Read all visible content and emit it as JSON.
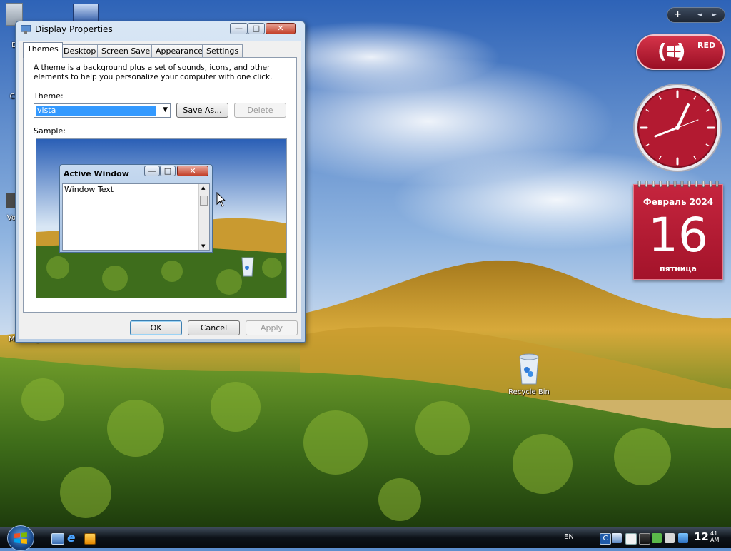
{
  "dialog": {
    "title": "Display Properties",
    "tabs": [
      "Themes",
      "Desktop",
      "Screen Saver",
      "Appearance",
      "Settings"
    ],
    "active_tab": "Themes",
    "description": "A theme is a background plus a set of sounds, icons, and other elements to help you personalize your computer with one click.",
    "theme_label": "Theme:",
    "theme_value": "vista",
    "save_as_label": "Save As...",
    "delete_label": "Delete",
    "sample_label": "Sample:",
    "ok_label": "OK",
    "cancel_label": "Cancel",
    "apply_label": "Apply"
  },
  "preview": {
    "window_title": "Active Window",
    "window_text": "Window Text"
  },
  "desktop": {
    "icons": {
      "messenger": "Messenger",
      "recycle_bin": "Recycle Bin"
    },
    "partial_labels": {
      "top": "D",
      "mid1": "C",
      "mid2": "Vo"
    }
  },
  "sidebar": {
    "red_label": "RED",
    "calendar": {
      "month_year": "Февраль 2024",
      "day": "16",
      "weekday": "пятница"
    },
    "clock_hour_hand": "wedge-to-4",
    "controls": [
      "+",
      "◄",
      "►"
    ]
  },
  "taskbar": {
    "language": "EN",
    "time": "12",
    "time_minutes": "41",
    "time_ampm": "AM"
  },
  "colors": {
    "accent_red": "#b8192f",
    "selection_blue": "#3399ff",
    "title_blue": "#4b6e95"
  },
  "icons": {
    "dialog": "display-icon",
    "start": "windows-orb-icon",
    "quick_launch": [
      "show-desktop-icon",
      "internet-explorer-icon",
      "media-player-icon"
    ],
    "tray": [
      "tray-c-icon",
      "tray-network-icon",
      "tray-mail-icon",
      "tray-monitor-icon",
      "tray-check-icon",
      "tray-volume-icon"
    ]
  }
}
